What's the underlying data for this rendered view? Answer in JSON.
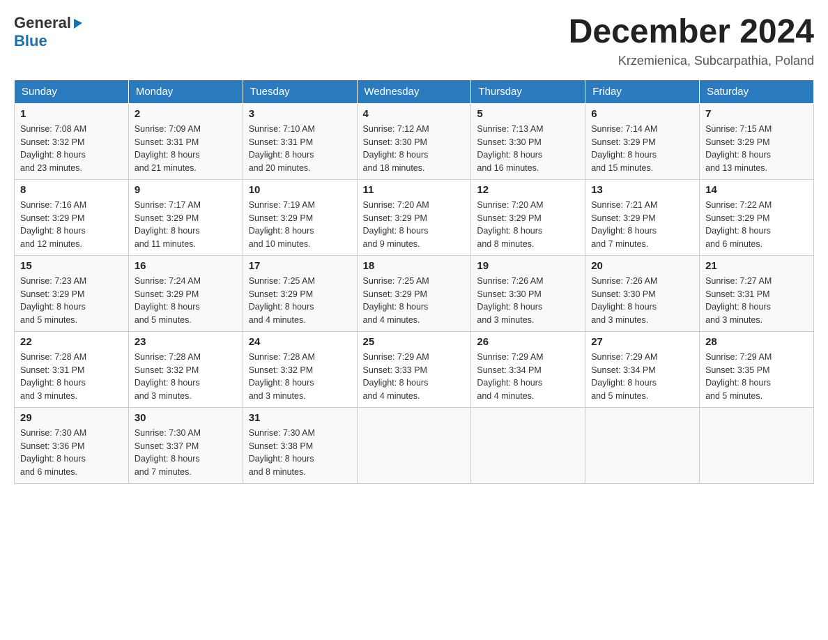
{
  "header": {
    "month_title": "December 2024",
    "location": "Krzemienica, Subcarpathia, Poland",
    "logo_general": "General",
    "logo_blue": "Blue"
  },
  "weekdays": [
    "Sunday",
    "Monday",
    "Tuesday",
    "Wednesday",
    "Thursday",
    "Friday",
    "Saturday"
  ],
  "weeks": [
    [
      {
        "day": "1",
        "sunrise": "7:08 AM",
        "sunset": "3:32 PM",
        "daylight": "8 hours and 23 minutes."
      },
      {
        "day": "2",
        "sunrise": "7:09 AM",
        "sunset": "3:31 PM",
        "daylight": "8 hours and 21 minutes."
      },
      {
        "day": "3",
        "sunrise": "7:10 AM",
        "sunset": "3:31 PM",
        "daylight": "8 hours and 20 minutes."
      },
      {
        "day": "4",
        "sunrise": "7:12 AM",
        "sunset": "3:30 PM",
        "daylight": "8 hours and 18 minutes."
      },
      {
        "day": "5",
        "sunrise": "7:13 AM",
        "sunset": "3:30 PM",
        "daylight": "8 hours and 16 minutes."
      },
      {
        "day": "6",
        "sunrise": "7:14 AM",
        "sunset": "3:29 PM",
        "daylight": "8 hours and 15 minutes."
      },
      {
        "day": "7",
        "sunrise": "7:15 AM",
        "sunset": "3:29 PM",
        "daylight": "8 hours and 13 minutes."
      }
    ],
    [
      {
        "day": "8",
        "sunrise": "7:16 AM",
        "sunset": "3:29 PM",
        "daylight": "8 hours and 12 minutes."
      },
      {
        "day": "9",
        "sunrise": "7:17 AM",
        "sunset": "3:29 PM",
        "daylight": "8 hours and 11 minutes."
      },
      {
        "day": "10",
        "sunrise": "7:19 AM",
        "sunset": "3:29 PM",
        "daylight": "8 hours and 10 minutes."
      },
      {
        "day": "11",
        "sunrise": "7:20 AM",
        "sunset": "3:29 PM",
        "daylight": "8 hours and 9 minutes."
      },
      {
        "day": "12",
        "sunrise": "7:20 AM",
        "sunset": "3:29 PM",
        "daylight": "8 hours and 8 minutes."
      },
      {
        "day": "13",
        "sunrise": "7:21 AM",
        "sunset": "3:29 PM",
        "daylight": "8 hours and 7 minutes."
      },
      {
        "day": "14",
        "sunrise": "7:22 AM",
        "sunset": "3:29 PM",
        "daylight": "8 hours and 6 minutes."
      }
    ],
    [
      {
        "day": "15",
        "sunrise": "7:23 AM",
        "sunset": "3:29 PM",
        "daylight": "8 hours and 5 minutes."
      },
      {
        "day": "16",
        "sunrise": "7:24 AM",
        "sunset": "3:29 PM",
        "daylight": "8 hours and 5 minutes."
      },
      {
        "day": "17",
        "sunrise": "7:25 AM",
        "sunset": "3:29 PM",
        "daylight": "8 hours and 4 minutes."
      },
      {
        "day": "18",
        "sunrise": "7:25 AM",
        "sunset": "3:29 PM",
        "daylight": "8 hours and 4 minutes."
      },
      {
        "day": "19",
        "sunrise": "7:26 AM",
        "sunset": "3:30 PM",
        "daylight": "8 hours and 3 minutes."
      },
      {
        "day": "20",
        "sunrise": "7:26 AM",
        "sunset": "3:30 PM",
        "daylight": "8 hours and 3 minutes."
      },
      {
        "day": "21",
        "sunrise": "7:27 AM",
        "sunset": "3:31 PM",
        "daylight": "8 hours and 3 minutes."
      }
    ],
    [
      {
        "day": "22",
        "sunrise": "7:28 AM",
        "sunset": "3:31 PM",
        "daylight": "8 hours and 3 minutes."
      },
      {
        "day": "23",
        "sunrise": "7:28 AM",
        "sunset": "3:32 PM",
        "daylight": "8 hours and 3 minutes."
      },
      {
        "day": "24",
        "sunrise": "7:28 AM",
        "sunset": "3:32 PM",
        "daylight": "8 hours and 3 minutes."
      },
      {
        "day": "25",
        "sunrise": "7:29 AM",
        "sunset": "3:33 PM",
        "daylight": "8 hours and 4 minutes."
      },
      {
        "day": "26",
        "sunrise": "7:29 AM",
        "sunset": "3:34 PM",
        "daylight": "8 hours and 4 minutes."
      },
      {
        "day": "27",
        "sunrise": "7:29 AM",
        "sunset": "3:34 PM",
        "daylight": "8 hours and 5 minutes."
      },
      {
        "day": "28",
        "sunrise": "7:29 AM",
        "sunset": "3:35 PM",
        "daylight": "8 hours and 5 minutes."
      }
    ],
    [
      {
        "day": "29",
        "sunrise": "7:30 AM",
        "sunset": "3:36 PM",
        "daylight": "8 hours and 6 minutes."
      },
      {
        "day": "30",
        "sunrise": "7:30 AM",
        "sunset": "3:37 PM",
        "daylight": "8 hours and 7 minutes."
      },
      {
        "day": "31",
        "sunrise": "7:30 AM",
        "sunset": "3:38 PM",
        "daylight": "8 hours and 8 minutes."
      },
      null,
      null,
      null,
      null
    ]
  ],
  "labels": {
    "sunrise": "Sunrise:",
    "sunset": "Sunset:",
    "daylight": "Daylight:"
  },
  "colors": {
    "header_bg": "#2a7abf",
    "accent": "#1a6faf"
  }
}
